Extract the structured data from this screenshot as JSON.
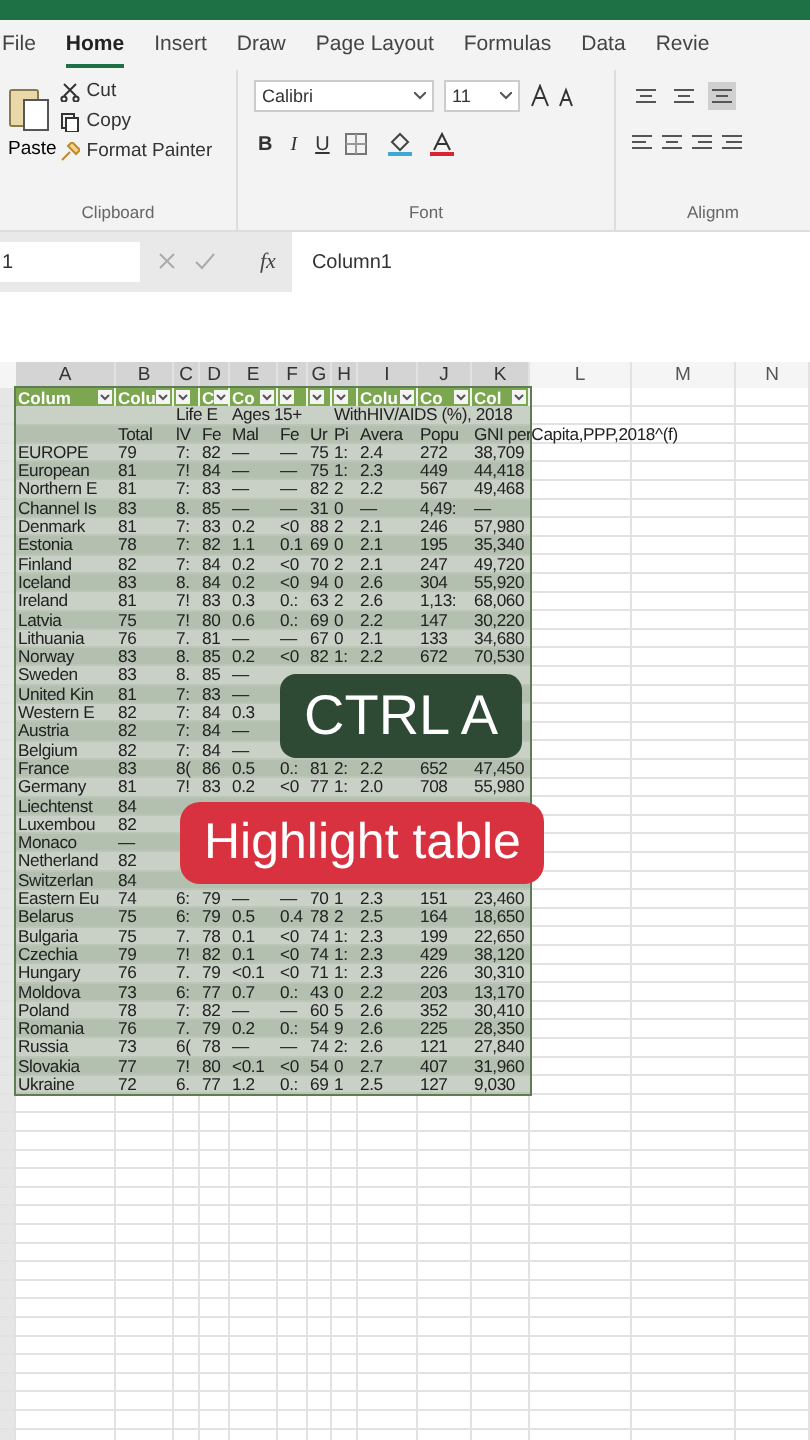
{
  "ribbon_tabs": [
    {
      "label": "File",
      "selected": false
    },
    {
      "label": "Home",
      "selected": true
    },
    {
      "label": "Insert",
      "selected": false
    },
    {
      "label": "Draw",
      "selected": false
    },
    {
      "label": "Page Layout",
      "selected": false
    },
    {
      "label": "Formulas",
      "selected": false
    },
    {
      "label": "Data",
      "selected": false
    },
    {
      "label": "Revie",
      "selected": false
    }
  ],
  "clipboard": {
    "paste": "Paste",
    "cut": "Cut",
    "copy": "Copy",
    "format_painter": "Format Painter",
    "group": "Clipboard"
  },
  "font": {
    "name": "Calibri",
    "size": "11",
    "bold": "B",
    "italic": "I",
    "underline": "U",
    "group": "Font"
  },
  "alignment": {
    "group": "Alignm",
    "vertical_buttons": [
      {
        "selected": false
      },
      {
        "selected": false
      },
      {
        "selected": true
      }
    ]
  },
  "formula_bar": {
    "name_box": "1",
    "fx": "fx",
    "value": "Column1"
  },
  "sheet": {
    "columns": [
      {
        "letter": "A",
        "selected": true,
        "table_header": "Colum"
      },
      {
        "letter": "B",
        "selected": true,
        "table_header": "Colu"
      },
      {
        "letter": "C",
        "selected": true
      },
      {
        "letter": "D",
        "selected": true,
        "table_header": "C"
      },
      {
        "letter": "E",
        "selected": true,
        "table_header": "Co"
      },
      {
        "letter": "F",
        "selected": true
      },
      {
        "letter": "G",
        "selected": true
      },
      {
        "letter": "H",
        "selected": true
      },
      {
        "letter": "I",
        "selected": true,
        "table_header": "Colu"
      },
      {
        "letter": "J",
        "selected": true,
        "table_header": "Co"
      },
      {
        "letter": "K",
        "selected": true,
        "table_header": "Col"
      },
      {
        "letter": "L",
        "selected": false
      },
      {
        "letter": "M",
        "selected": false
      },
      {
        "letter": "N",
        "selected": false
      }
    ],
    "table": {
      "selected": true,
      "rows": [
        [
          null,
          null,
          "Life E",
          null,
          "Ages 15+",
          null,
          null,
          "WithHIV/AIDS (%), 2018",
          null,
          null,
          null
        ],
        [
          null,
          "Total",
          "lV",
          "Fe",
          "Mal",
          "Fe",
          "Ur",
          "Pi",
          "Avera",
          "Popu",
          "GNI perCapita,PPP,2018^(f)"
        ],
        [
          "EUROPE",
          "79",
          "7:",
          "82",
          "—",
          "—",
          "75",
          "1:",
          "2.4",
          "272",
          "38,709"
        ],
        [
          "European",
          "81",
          "7!",
          "84",
          "—",
          "—",
          "75",
          "1:",
          "2.3",
          "449",
          "44,418"
        ],
        [
          "Northern E",
          "81",
          "7:",
          "83",
          "—",
          "—",
          "82",
          "2",
          "2.2",
          "567",
          "49,468"
        ],
        [
          "Channel Is",
          "83",
          "8.",
          "85",
          "—",
          "—",
          "31",
          "0",
          "—",
          "4,49:",
          "—"
        ],
        [
          "Denmark",
          "81",
          "7:",
          "83",
          "0.2",
          "<0",
          "88",
          "2",
          "2.1",
          "246",
          "57,980"
        ],
        [
          "Estonia",
          "78",
          "7:",
          "82",
          "1.1",
          "0.1",
          "69",
          "0",
          "2.1",
          "195",
          "35,340"
        ],
        [
          "Finland",
          "82",
          "7:",
          "84",
          "0.2",
          "<0",
          "70",
          "2",
          "2.1",
          "247",
          "49,720"
        ],
        [
          "Iceland",
          "83",
          "8.",
          "84",
          "0.2",
          "<0",
          "94",
          "0",
          "2.6",
          "304",
          "55,920"
        ],
        [
          "Ireland",
          "81",
          "7!",
          "83",
          "0.3",
          "0.:",
          "63",
          "2",
          "2.6",
          "1,13:",
          "68,060"
        ],
        [
          "Latvia",
          "75",
          "7!",
          "80",
          "0.6",
          "0.:",
          "69",
          "0",
          "2.2",
          "147",
          "30,220"
        ],
        [
          "Lithuania",
          "76",
          "7.",
          "81",
          "—",
          "—",
          "67",
          "0",
          "2.1",
          "133",
          "34,680"
        ],
        [
          "Norway",
          "83",
          "8.",
          "85",
          "0.2",
          "<0",
          "82",
          "1:",
          "2.2",
          "672",
          "70,530"
        ],
        [
          "Sweden",
          "83",
          "8.",
          "85",
          "—",
          null,
          null,
          null,
          null,
          null,
          null
        ],
        [
          "United Kin",
          "81",
          "7:",
          "83",
          "—",
          null,
          null,
          null,
          null,
          null,
          null
        ],
        [
          "Western E",
          "82",
          "7:",
          "84",
          "0.3",
          null,
          null,
          null,
          null,
          null,
          null
        ],
        [
          "Austria",
          "82",
          "7:",
          "84",
          "—",
          null,
          null,
          null,
          null,
          null,
          null
        ],
        [
          "Belgium",
          "82",
          "7:",
          "84",
          "—",
          null,
          null,
          null,
          null,
          null,
          null
        ],
        [
          "France",
          "83",
          "8(",
          "86",
          "0.5",
          "0.:",
          "81",
          "2:",
          "2.2",
          "652",
          "47,450"
        ],
        [
          "Germany",
          "81",
          "7!",
          "83",
          "0.2",
          "<0",
          "77",
          "1:",
          "2.0",
          "708",
          "55,980"
        ],
        [
          "Liechtenst",
          "84",
          null,
          null,
          null,
          null,
          null,
          null,
          null,
          null,
          null
        ],
        [
          "Luxembou",
          "82",
          null,
          null,
          null,
          null,
          null,
          null,
          null,
          null,
          null
        ],
        [
          "Monaco",
          "—",
          null,
          null,
          null,
          null,
          null,
          null,
          null,
          null,
          null
        ],
        [
          "Netherland",
          "82",
          null,
          null,
          null,
          null,
          null,
          null,
          null,
          null,
          null
        ],
        [
          "Switzerlan",
          "84",
          null,
          null,
          null,
          null,
          null,
          null,
          null,
          null,
          null
        ],
        [
          "Eastern Eu",
          "74",
          "6:",
          "79",
          "—",
          "—",
          "70",
          "1",
          "2.3",
          "151",
          "23,460"
        ],
        [
          "Belarus",
          "75",
          "6:",
          "79",
          "0.5",
          "0.4",
          "78",
          "2",
          "2.5",
          "164",
          "18,650"
        ],
        [
          "Bulgaria",
          "75",
          "7.",
          "78",
          "0.1",
          "<0",
          "74",
          "1:",
          "2.3",
          "199",
          "22,650"
        ],
        [
          "Czechia",
          "79",
          "7!",
          "82",
          "0.1",
          "<0",
          "74",
          "1:",
          "2.3",
          "429",
          "38,120"
        ],
        [
          "Hungary",
          "76",
          "7.",
          "79",
          "<0.1",
          "<0",
          "71",
          "1:",
          "2.3",
          "226",
          "30,310"
        ],
        [
          "Moldova",
          "73",
          "6:",
          "77",
          "0.7",
          "0.:",
          "43",
          "0",
          "2.2",
          "203",
          "13,170"
        ],
        [
          "Poland",
          "78",
          "7:",
          "82",
          "—",
          "—",
          "60",
          "5",
          "2.6",
          "352",
          "30,410"
        ],
        [
          "Romania",
          "76",
          "7.",
          "79",
          "0.2",
          "0.:",
          "54",
          "9",
          "2.6",
          "225",
          "28,350"
        ],
        [
          "Russia",
          "73",
          "6(",
          "78",
          "—",
          "—",
          "74",
          "2:",
          "2.6",
          "121",
          "27,840"
        ],
        [
          "Slovakia",
          "77",
          "7!",
          "80",
          "<0.1",
          "<0",
          "54",
          "0",
          "2.7",
          "407",
          "31,960"
        ],
        [
          "Ukraine",
          "72",
          "6.",
          "77",
          "1.2",
          "0.:",
          "69",
          "1",
          "2.5",
          "127",
          "9,030"
        ]
      ]
    }
  },
  "captions": [
    {
      "text": "CTRL A",
      "kind": "shortcut"
    },
    {
      "text": "Highlight table",
      "kind": "action"
    }
  ]
}
